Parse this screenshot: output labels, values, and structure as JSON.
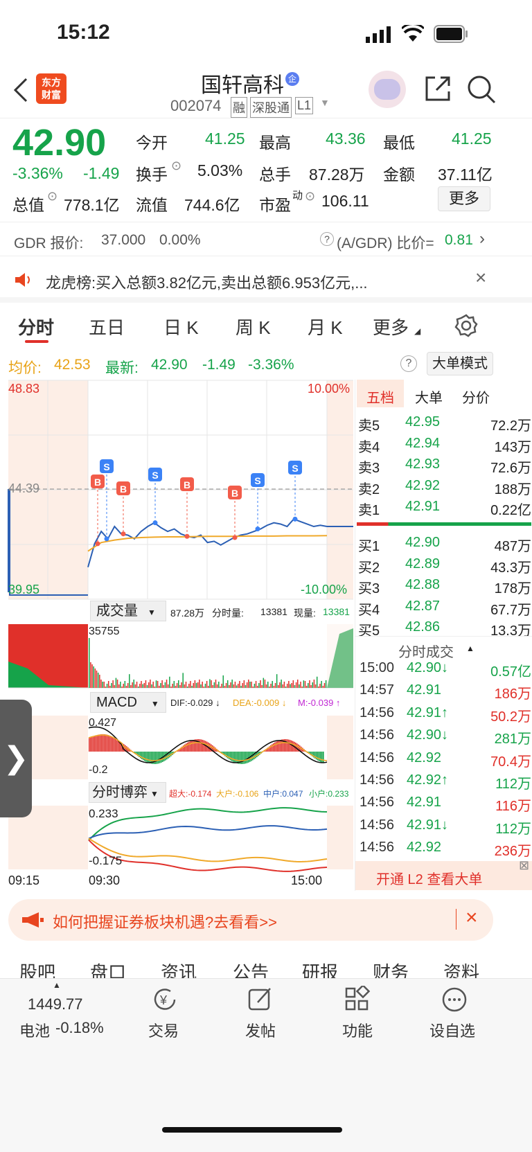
{
  "status_bar": {
    "time": "15:12"
  },
  "header": {
    "title": "国轩高科",
    "badge": "企",
    "code": "002074",
    "tags": [
      "融",
      "深股通",
      "L1"
    ]
  },
  "quote": {
    "price": "42.90",
    "pct": "-3.36%",
    "chg": "-1.49",
    "row1": [
      [
        "今开",
        "41.25"
      ],
      [
        "最高",
        "43.36"
      ],
      [
        "最低",
        "41.25"
      ]
    ],
    "row2": [
      [
        "换手",
        "5.03%"
      ],
      [
        "总手",
        "87.28万"
      ],
      [
        "金额",
        "37.11亿"
      ]
    ],
    "row3": [
      [
        "总值",
        "778.1亿"
      ],
      [
        "流值",
        "744.6亿"
      ],
      [
        "市盈",
        "106.11"
      ]
    ],
    "pe_sup": "动",
    "more": "更多"
  },
  "gdr": {
    "label": "GDR 报价:",
    "price": "37.000",
    "pct": "0.00%",
    "ratio_label": "(A/GDR) 比价=",
    "ratio": "0.81"
  },
  "notice": {
    "text": "龙虎榜:买入总额3.82亿元,卖出总额6.953亿元,..."
  },
  "tabs": [
    "分时",
    "五日",
    "日 K",
    "周 K",
    "月 K",
    "更多"
  ],
  "info": {
    "avg_label": "均价:",
    "avg": "42.53",
    "last_label": "最新:",
    "last": "42.90",
    "chg": "-1.49",
    "pct": "-3.36%",
    "mode_btn": "大单模式"
  },
  "chart_data": {
    "type": "line",
    "title": "",
    "x_ticks": [
      "09:15",
      "09:30",
      "15:00"
    ],
    "y_top": "48.83",
    "y_mid": "44.39",
    "y_bot": "39.95",
    "pct_top": "10.00%",
    "pct_bot": "-10.00%",
    "price": [
      41.25,
      42.2,
      42.7,
      42.4,
      42.9,
      42.6,
      42.55,
      42.4,
      42.7,
      42.9,
      43.05,
      42.85,
      42.7,
      42.8,
      42.6,
      42.5,
      42.45,
      42.55,
      42.25,
      42.3,
      42.15,
      42.3,
      42.45,
      42.55,
      42.6,
      42.7,
      42.8,
      42.95,
      43.05,
      43.0,
      42.9,
      43.2,
      43.1,
      43.0,
      42.9,
      42.95,
      42.9
    ],
    "avg": [
      41.9,
      42.25,
      42.35,
      42.42,
      42.45,
      42.47,
      42.48,
      42.48,
      42.49,
      42.5,
      42.5,
      42.5,
      42.51,
      42.51,
      42.51,
      42.52,
      42.52,
      42.52,
      42.53
    ],
    "markers": [
      "S",
      "B",
      "B",
      "S",
      "B",
      "B",
      "S",
      "S"
    ]
  },
  "volume": {
    "label": "成交量",
    "total": "87.28万",
    "fsl_label": "分时量:",
    "fsl": "13381",
    "xl_label": "现量:",
    "xl": "13381",
    "max": "35755"
  },
  "macd": {
    "label": "MACD",
    "dif": "DIF:-0.029 ↓",
    "dea": "DEA:-0.009 ↓",
    "m": "M:-0.039 ↑",
    "top": "0.427",
    "bot": "-0.2"
  },
  "game": {
    "label": "分时博弈",
    "cd": "超大:-0.174",
    "dh": "大户:-0.106",
    "zh": "中户:0.047",
    "xh": "小户:0.233",
    "top": "0.233",
    "bot": "-0.175"
  },
  "orderbook": {
    "tabs": [
      "五档",
      "大单",
      "分价"
    ],
    "sells": [
      [
        "卖5",
        "42.95",
        "72.2万"
      ],
      [
        "卖4",
        "42.94",
        "143万"
      ],
      [
        "卖3",
        "42.93",
        "72.6万"
      ],
      [
        "卖2",
        "42.92",
        "188万"
      ],
      [
        "卖1",
        "42.91",
        "0.22亿"
      ]
    ],
    "buys": [
      [
        "买1",
        "42.90",
        "487万"
      ],
      [
        "买2",
        "42.89",
        "43.3万"
      ],
      [
        "买3",
        "42.88",
        "178万"
      ],
      [
        "买4",
        "42.87",
        "67.7万"
      ],
      [
        "买5",
        "42.86",
        "13.3万"
      ]
    ]
  },
  "trades": {
    "title": "分时成交",
    "rows": [
      [
        "15:00",
        "42.90↓",
        "0.57亿",
        "g"
      ],
      [
        "14:57",
        "42.91",
        "186万",
        "r"
      ],
      [
        "14:56",
        "42.91↑",
        "50.2万",
        "r"
      ],
      [
        "14:56",
        "42.90↓",
        "281万",
        "g"
      ],
      [
        "14:56",
        "42.92",
        "70.4万",
        "r"
      ],
      [
        "14:56",
        "42.92↑",
        "112万",
        "g"
      ],
      [
        "14:56",
        "42.91",
        "116万",
        "r"
      ],
      [
        "14:56",
        "42.91↓",
        "112万",
        "g"
      ],
      [
        "14:56",
        "42.92",
        "236万",
        "r"
      ]
    ],
    "l2": "开通 L2 查看大单"
  },
  "promo": {
    "text": "如何把握证券板块机遇?去看看>>"
  },
  "bottom_tabs": [
    "股吧",
    "盘口",
    "资讯",
    "公告",
    "研报",
    "财务",
    "资料"
  ],
  "nav": {
    "index_val": "1449.77",
    "index_name": "电池",
    "index_pct": "-0.18%",
    "items": [
      "交易",
      "发帖",
      "功能",
      "设自选"
    ]
  }
}
